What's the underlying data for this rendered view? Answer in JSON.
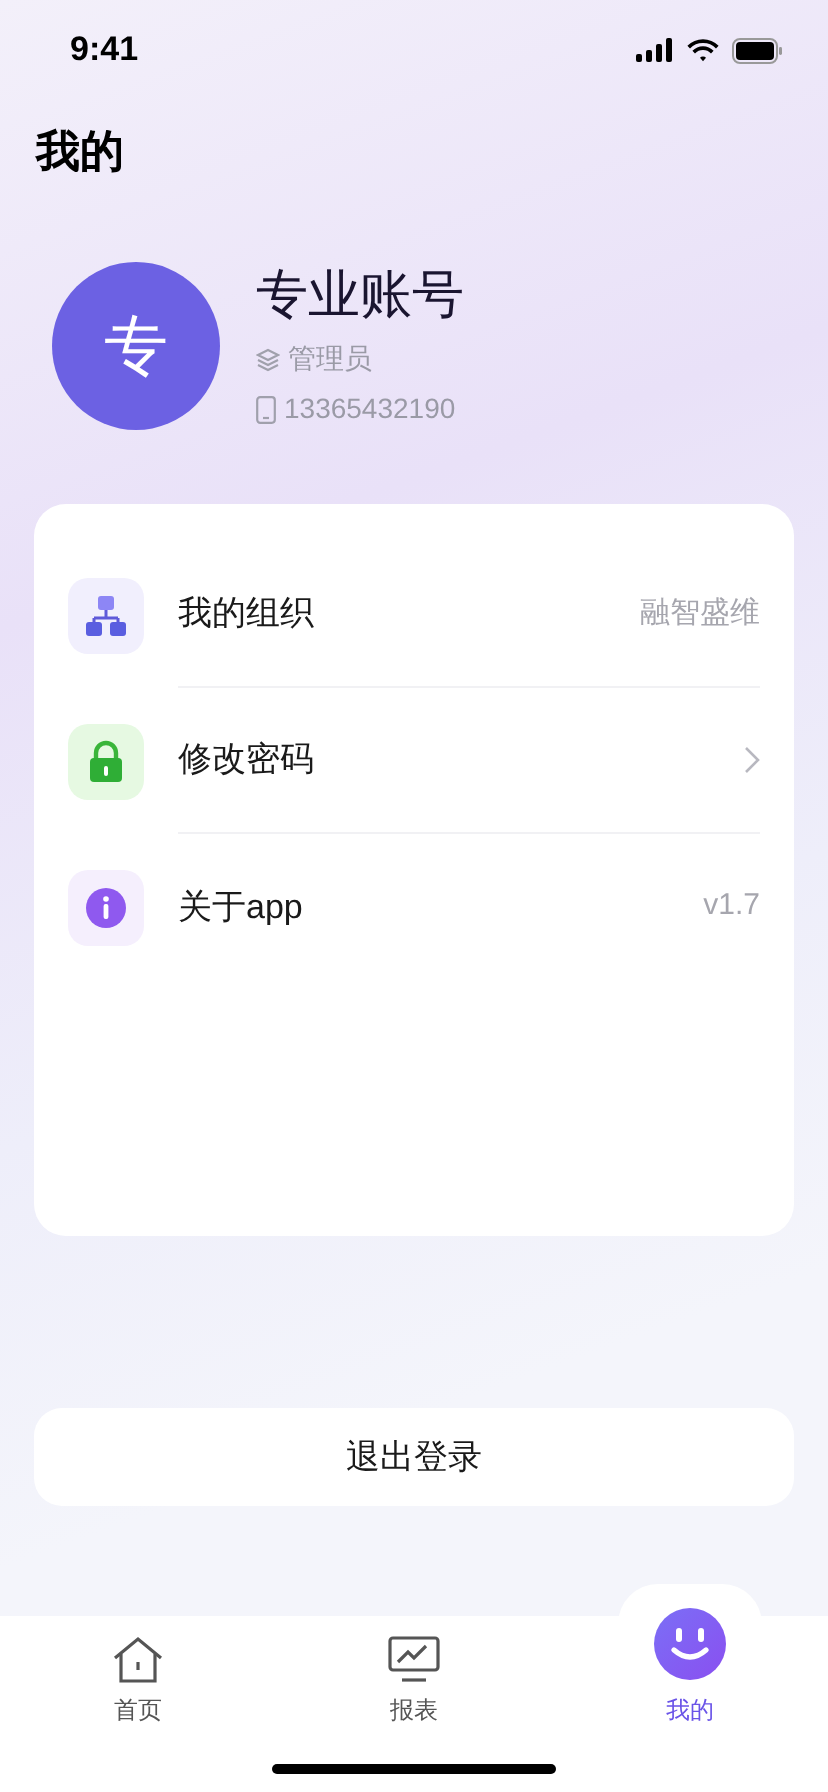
{
  "status_bar": {
    "time": "9:41"
  },
  "title": "我的",
  "profile": {
    "avatar_text": "专",
    "name": "专业账号",
    "role": "管理员",
    "phone": "13365432190"
  },
  "menu": [
    {
      "label": "我的组织",
      "kind": "value",
      "value": "融智盛维"
    },
    {
      "label": "修改密码",
      "kind": "link"
    },
    {
      "label": "关于app",
      "kind": "value",
      "value": "v1.7"
    }
  ],
  "logout_button": "退出登录",
  "tabs": [
    {
      "label": "首页",
      "selected": false
    },
    {
      "label": "报表",
      "selected": false
    },
    {
      "label": "我的",
      "selected": true
    }
  ]
}
